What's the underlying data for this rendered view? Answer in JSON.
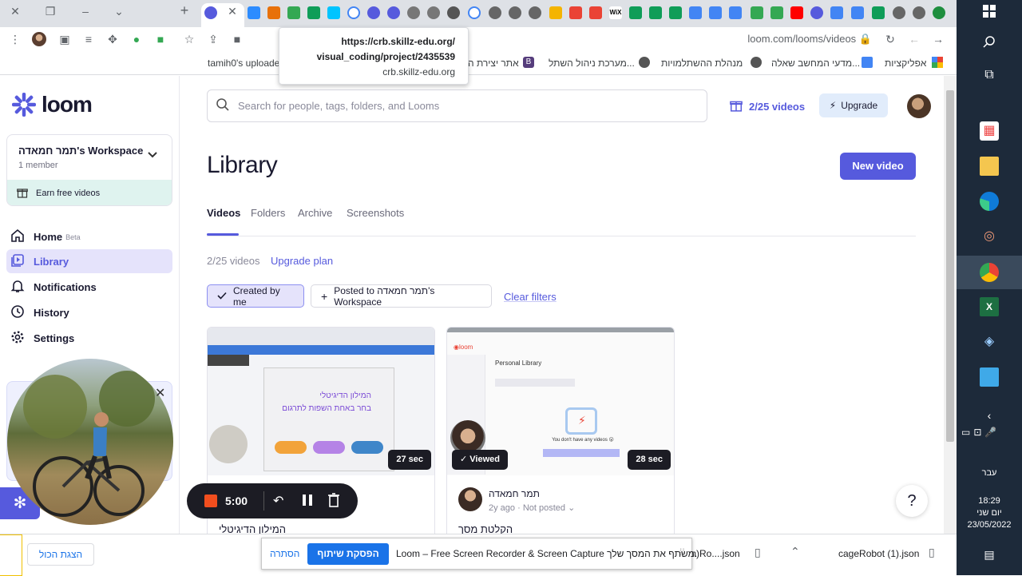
{
  "browser": {
    "tooltip": {
      "line1": "https://crb.skillz-edu.org/",
      "line2": "visual_coding/project/2435539",
      "line3": "crb.skillz-edu.org"
    },
    "url": "loom.com/looms/videos",
    "bookmarks": [
      "tamih0's uploaded",
      "אתר יצירת ה",
      "מערכת ניהול השתל...",
      "מנהלת ההשתלמויות",
      "מדעי המחשב שאלה...",
      "אפליקציות"
    ]
  },
  "sidebar": {
    "logo": "loom",
    "workspace_name": "תמר חמאדה's Workspace",
    "workspace_members": "1 member",
    "earn": "Earn free videos",
    "nav": [
      {
        "label": "Home",
        "badge": "Beta"
      },
      {
        "label": "Library"
      },
      {
        "label": "Notifications"
      },
      {
        "label": "History"
      },
      {
        "label": "Settings"
      }
    ]
  },
  "header": {
    "search_placeholder": "Search for people, tags, folders, and Looms",
    "videos_count": "2/25 videos",
    "upgrade": "Upgrade"
  },
  "library": {
    "title": "Library",
    "new_video": "New video",
    "tabs": [
      "Videos",
      "Folders",
      "Archive",
      "Screenshots"
    ],
    "count": "2/25 videos",
    "upgrade_plan": "Upgrade plan",
    "filter_created": "Created by me",
    "filter_posted": "Posted to תמר חמאדה's Workspace",
    "clear_filters": "Clear filters",
    "cards": [
      {
        "duration": "27 sec",
        "title": "המילון הדיגיטלי",
        "thumb_line1": "המילון הדיגיטלי",
        "thumb_line2": "בחר באחת השפות לתרגום"
      },
      {
        "duration": "28 sec",
        "viewed": "Viewed",
        "author": "תמר חמאדה",
        "age": "2y ago",
        "status": "Not posted",
        "title": "הקלטת מסך",
        "thumb_heading": "Personal Library",
        "thumb_note": "You don't have any videos 😮"
      }
    ]
  },
  "recorder": {
    "time": "5:00"
  },
  "help": "?",
  "downloads": {
    "show_all": "הצגת הכול",
    "share_text": "Loom – Free Screen Recorder & Screen Capture משתף את המסך שלך.",
    "stop_share": "הפסקת שיתוף",
    "hide": "הסתרה",
    "file1": "m)Ro....json",
    "file2": "cageRobot (1).json"
  },
  "taskbar": {
    "lang": "עבר",
    "time": "18:29",
    "day": "יום שני",
    "date": "23/05/2022"
  },
  "colors": {
    "accent": "#565add",
    "earn_bg": "#dff3ef",
    "active_nav": "#e5e3fb"
  }
}
